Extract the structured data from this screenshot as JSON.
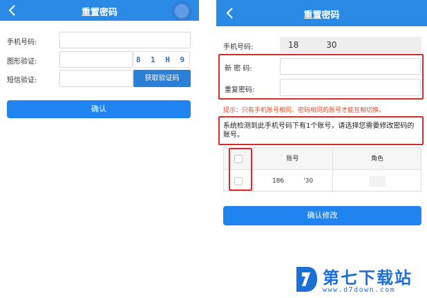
{
  "left": {
    "title": "重置密码",
    "phone_label": "手机号码:",
    "captcha_label": "图形验证:",
    "captcha_text": "8 1 H 9",
    "sms_label": "短信验证:",
    "sms_button": "获取验证码",
    "confirm_button": "确认"
  },
  "right": {
    "title": "重置密码",
    "phone_label": "手机号码:",
    "phone_start": "18",
    "phone_end": "30",
    "new_pwd_label": "新  密  码:",
    "repeat_pwd_label": "重复密码:",
    "hint": "提示：只有手机账号相同、密码相同的账号才能互相切换。",
    "notice": "系统检测到此手机号码下有1个账号，请选择您需要修改密码的账号。",
    "table": {
      "headers": [
        "账号",
        "角色"
      ],
      "row": {
        "account_start": "186",
        "account_end": "'30"
      }
    },
    "confirm_button": "确认修改"
  },
  "watermark": {
    "title": "第七下载站",
    "url": "www.d7down.com"
  },
  "colors": {
    "nav": "#2a8ae6",
    "button": "#1f84f0",
    "highlight": "#d62b2b",
    "hint": "#e04c2e",
    "brand": "#1d6fd8"
  }
}
